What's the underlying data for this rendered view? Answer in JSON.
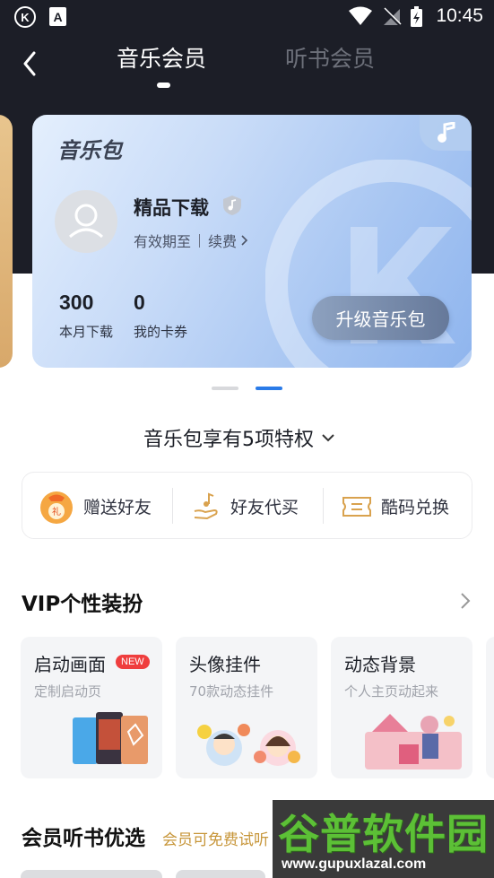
{
  "status_bar": {
    "time": "10:45",
    "k_icon_text": "K",
    "a_icon_text": "A"
  },
  "nav": {
    "tabs": [
      {
        "label": "音乐会员"
      },
      {
        "label": "听书会员"
      }
    ]
  },
  "card": {
    "title": "音乐包",
    "plan_name": "精品下载",
    "validity_label": "有效期至",
    "renew_label": "续费",
    "stats": [
      {
        "value": "300",
        "label": "本月下载"
      },
      {
        "value": "0",
        "label": "我的卡券"
      }
    ],
    "upgrade_button": "升级音乐包"
  },
  "privileges": {
    "title": "音乐包享有5项特权",
    "items": [
      {
        "label": "赠送好友",
        "icon": "gift-bag-icon"
      },
      {
        "label": "好友代买",
        "icon": "hand-music-icon"
      },
      {
        "label": "酷码兑换",
        "icon": "ticket-icon"
      }
    ]
  },
  "vip_section": {
    "title": "VIP个性装扮",
    "cards": [
      {
        "title": "启动画面",
        "badge": "NEW",
        "subtitle": "定制启动页"
      },
      {
        "title": "头像挂件",
        "subtitle": "70款动态挂件"
      },
      {
        "title": "动态背景",
        "subtitle": "个人主页动起来"
      }
    ]
  },
  "books_section": {
    "title": "会员听书优选",
    "subtitle": "会员可免费试听"
  },
  "watermark": {
    "text": "谷普软件园",
    "url": "www.gupuxlazal.com"
  },
  "colors": {
    "dark_header": "#1c1e27",
    "accent_blue": "#2a7be8",
    "gold": "#c7963a",
    "badge_red": "#ef3e3e"
  }
}
